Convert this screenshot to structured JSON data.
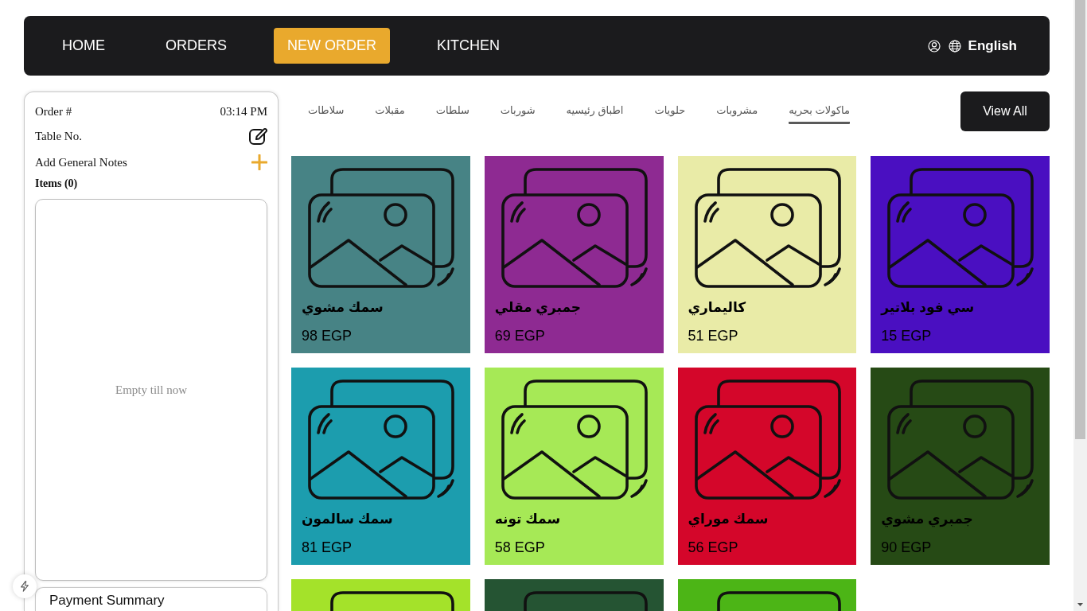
{
  "nav": {
    "links": [
      {
        "label": "KITCHEN",
        "selected": false
      },
      {
        "label": "NEW ORDER",
        "selected": true
      },
      {
        "label": "ORDERS",
        "selected": false
      },
      {
        "label": "HOME",
        "selected": false
      }
    ],
    "language": "English"
  },
  "order_panel": {
    "order_label": "Order #",
    "time": "03:14 PM",
    "table_label": "Table No.",
    "notes_label": "Add General Notes",
    "items_label": "Items (0)",
    "empty_text": "Empty till now",
    "payment_title": "Payment Summary"
  },
  "categories": {
    "tabs": [
      {
        "label": "ماكولات بحريه",
        "selected": true
      },
      {
        "label": "مشروبات",
        "selected": false
      },
      {
        "label": "حلويات",
        "selected": false
      },
      {
        "label": "اطباق رئيسيه",
        "selected": false
      },
      {
        "label": "شوربات",
        "selected": false
      },
      {
        "label": "سلطات",
        "selected": false
      },
      {
        "label": "مقبلات",
        "selected": false
      },
      {
        "label": "سلاطات",
        "selected": false
      }
    ],
    "view_all": "View All"
  },
  "products": [
    {
      "name": "سي فود بلاتير",
      "price": "15 EGP",
      "color": "#4a0fc1"
    },
    {
      "name": "كاليماري",
      "price": "51 EGP",
      "color": "#e9eba7"
    },
    {
      "name": "جمبري مقلي",
      "price": "69 EGP",
      "color": "#8e2a92"
    },
    {
      "name": "سمك مشوي",
      "price": "98 EGP",
      "color": "#478385"
    },
    {
      "name": "جمبري مشوي",
      "price": "90 EGP",
      "color": "#264a15"
    },
    {
      "name": "سمك موراي",
      "price": "56 EGP",
      "color": "#d4062a"
    },
    {
      "name": "سمك تونه",
      "price": "58 EGP",
      "color": "#a6e956"
    },
    {
      "name": "سمك سالمون",
      "price": "81 EGP",
      "color": "#1c9dae"
    },
    {
      "color": "#4cb516"
    },
    {
      "color": "#255433"
    },
    {
      "color": "#a4e22a"
    }
  ]
}
